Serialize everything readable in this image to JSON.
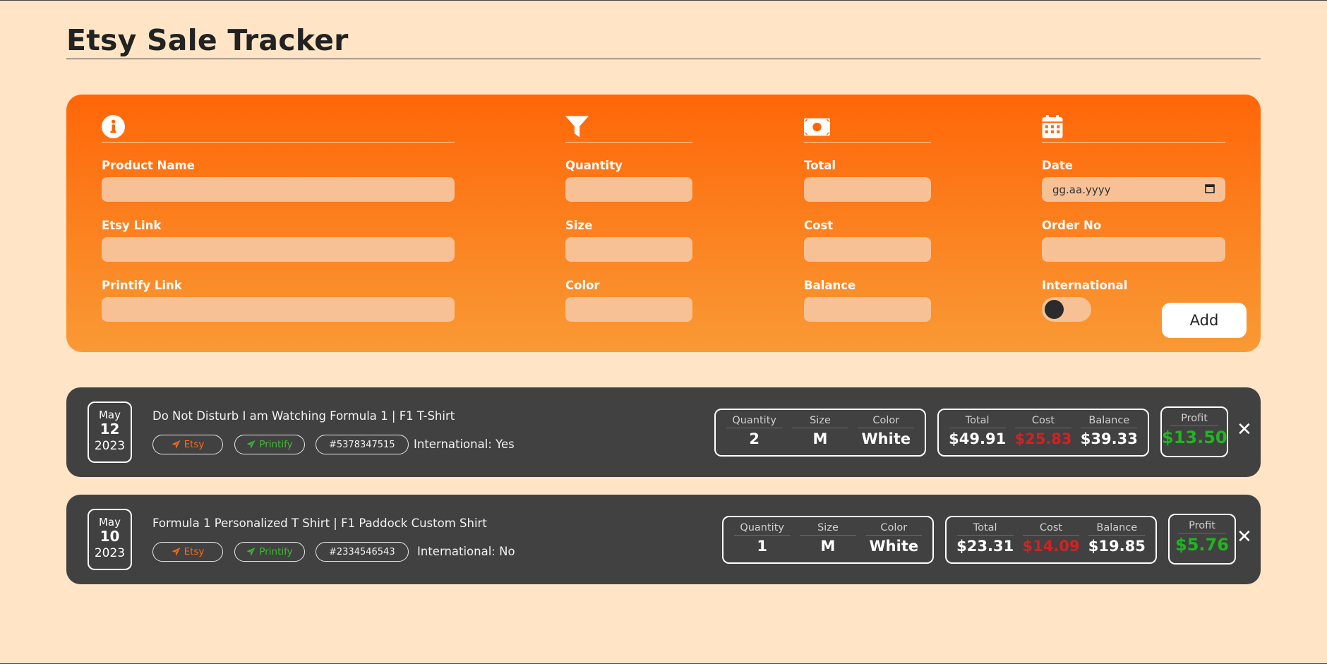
{
  "app": {
    "title": "Etsy Sale Tracker"
  },
  "form": {
    "fields": {
      "product_name": {
        "label": "Product Name",
        "value": ""
      },
      "etsy_link": {
        "label": "Etsy Link",
        "value": ""
      },
      "printify_link": {
        "label": "Printify Link",
        "value": ""
      },
      "quantity": {
        "label": "Quantity",
        "value": ""
      },
      "size": {
        "label": "Size",
        "value": ""
      },
      "color": {
        "label": "Color",
        "value": ""
      },
      "total": {
        "label": "Total",
        "value": ""
      },
      "cost": {
        "label": "Cost",
        "value": ""
      },
      "balance": {
        "label": "Balance",
        "value": ""
      },
      "date": {
        "label": "Date",
        "placeholder": "gg.aa.yyyy"
      },
      "order_no": {
        "label": "Order No",
        "value": ""
      },
      "international": {
        "label": "International",
        "checked": false
      }
    },
    "icons": [
      "info-icon",
      "filter-icon",
      "money-icon",
      "calendar-icon"
    ],
    "add_label": "Add"
  },
  "sales": [
    {
      "date": {
        "month": "May",
        "day": "12",
        "year": "2023"
      },
      "product": "Do Not Disturb I am Watching Formula 1 | F1 T-Shirt",
      "etsy_label": "Etsy",
      "printify_label": "Printify",
      "order_no": "#5378347515",
      "international": "International: Yes",
      "quantity": {
        "label": "Quantity",
        "value": "2"
      },
      "size": {
        "label": "Size",
        "value": "M"
      },
      "color": {
        "label": "Color",
        "value": "White"
      },
      "total": {
        "label": "Total",
        "value": "$49.91"
      },
      "cost": {
        "label": "Cost",
        "value": "$25.83"
      },
      "balance": {
        "label": "Balance",
        "value": "$39.33"
      },
      "profit": {
        "label": "Profit",
        "value": "$13.50"
      },
      "close": "✕"
    },
    {
      "date": {
        "month": "May",
        "day": "10",
        "year": "2023"
      },
      "product": "Formula 1 Personalized T Shirt | F1 Paddock Custom Shirt",
      "etsy_label": "Etsy",
      "printify_label": "Printify",
      "order_no": "#2334546543",
      "international": "International: No",
      "quantity": {
        "label": "Quantity",
        "value": "1"
      },
      "size": {
        "label": "Size",
        "value": "M"
      },
      "color": {
        "label": "Color",
        "value": "White"
      },
      "total": {
        "label": "Total",
        "value": "$23.31"
      },
      "cost": {
        "label": "Cost",
        "value": "$14.09"
      },
      "balance": {
        "label": "Balance",
        "value": "$19.85"
      },
      "profit": {
        "label": "Profit",
        "value": "$5.76"
      },
      "close": "✕"
    }
  ],
  "colors": {
    "background": "#ffe5c6",
    "panel_top": "#ff6608",
    "panel_bottom": "#f99a35",
    "input_bg": "#f7c195",
    "card_bg": "#414141",
    "etsy": "#ff6a13",
    "printify": "#3dbb33",
    "cost": "#d62020",
    "profit": "#21b521"
  }
}
